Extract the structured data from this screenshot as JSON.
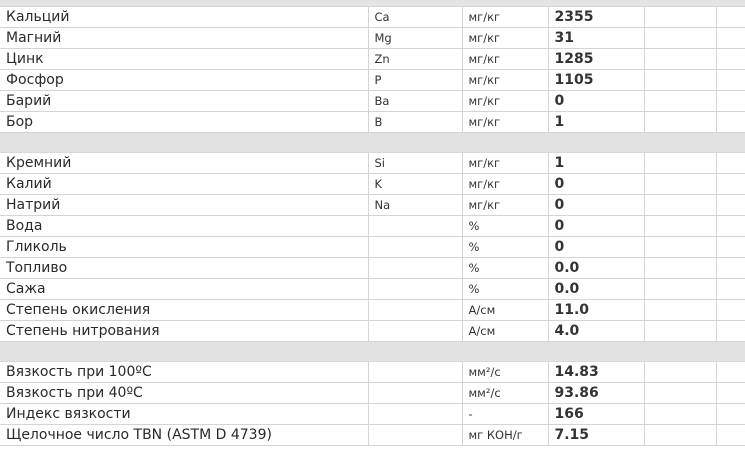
{
  "groups": [
    {
      "rows": [
        {
          "name": "Кальций",
          "symbol": "Ca",
          "unit": "мг/кг",
          "value": "2355"
        },
        {
          "name": "Магний",
          "symbol": "Mg",
          "unit": "мг/кг",
          "value": "31"
        },
        {
          "name": "Цинк",
          "symbol": "Zn",
          "unit": "мг/кг",
          "value": "1285"
        },
        {
          "name": "Фосфор",
          "symbol": "P",
          "unit": "мг/кг",
          "value": "1105"
        },
        {
          "name": "Барий",
          "symbol": "Ba",
          "unit": "мг/кг",
          "value": "0"
        },
        {
          "name": "Бор",
          "symbol": "B",
          "unit": "мг/кг",
          "value": "1"
        }
      ]
    },
    {
      "rows": [
        {
          "name": "Кремний",
          "symbol": "Si",
          "unit": "мг/кг",
          "value": "1"
        },
        {
          "name": "Калий",
          "symbol": "K",
          "unit": "мг/кг",
          "value": "0"
        },
        {
          "name": "Натрий",
          "symbol": "Na",
          "unit": "мг/кг",
          "value": "0"
        },
        {
          "name": "Вода",
          "symbol": "",
          "unit": "%",
          "value": "0"
        },
        {
          "name": "Гликоль",
          "symbol": "",
          "unit": "%",
          "value": "0"
        },
        {
          "name": "Топливо",
          "symbol": "",
          "unit": "%",
          "value": "0.0"
        },
        {
          "name": "Сажа",
          "symbol": "",
          "unit": "%",
          "value": "0.0"
        },
        {
          "name": "Степень окисления",
          "symbol": "",
          "unit": "А/см",
          "value": "11.0"
        },
        {
          "name": "Степень нитрования",
          "symbol": "",
          "unit": "А/см",
          "value": "4.0"
        }
      ]
    },
    {
      "rows": [
        {
          "name": "Вязкость при 100ºС",
          "symbol": "",
          "unit": "мм²/с",
          "value": "14.83"
        },
        {
          "name": "Вязкость при 40ºС",
          "symbol": "",
          "unit": "мм²/с",
          "value": "93.86"
        },
        {
          "name": "Индекс вязкости",
          "symbol": "",
          "unit": "-",
          "value": "166"
        },
        {
          "name": "Щелочное число TBN (ASTM D 4739)",
          "symbol": "",
          "unit": "мг КОН/г",
          "value": "7.15"
        }
      ]
    }
  ]
}
